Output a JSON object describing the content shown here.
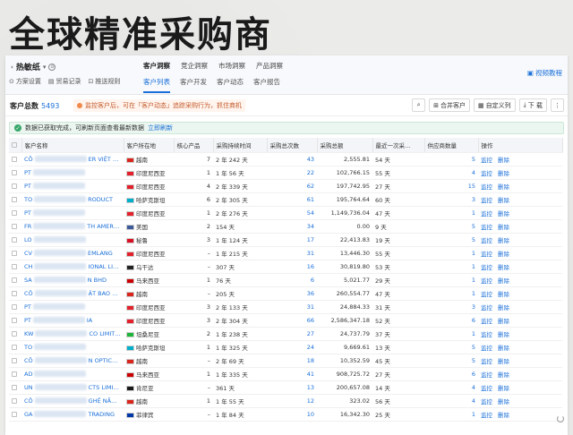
{
  "headline": "全球精准采购商",
  "topbar": {
    "product": "热敏纸",
    "sub_links": [
      "方案设置",
      "贸易记录",
      "推送规则"
    ],
    "main_tabs": [
      {
        "label": "客户洞察",
        "active": true
      },
      {
        "label": "竞企洞察",
        "active": false
      },
      {
        "label": "市场洞察",
        "active": false
      },
      {
        "label": "产品洞察",
        "active": false
      }
    ],
    "sub_tabs": [
      {
        "label": "客户列表",
        "active": true
      },
      {
        "label": "客户开发",
        "active": false
      },
      {
        "label": "客户动态",
        "active": false
      },
      {
        "label": "客户报告",
        "active": false
      }
    ],
    "video_tutorial": "视频教程"
  },
  "toolbar": {
    "total_label": "客户总数",
    "total_value": "5493",
    "warn_text": "监控客户后，可在「客户动态」追踪采购行为，抓住商机",
    "merge_label": "合并客户",
    "custom_cols_label": "自定义列",
    "download_label": "下 载"
  },
  "banner": {
    "text": "数据已获取完成，可刷新页面查看最新数据",
    "refresh": "立即刷新"
  },
  "table": {
    "headers": [
      "客户名称",
      "客户所在地",
      "核心产品",
      "采购持续时间",
      "采购总次数",
      "采购总额",
      "最近一次采…",
      "供应商数量",
      "操作"
    ],
    "rows": [
      {
        "name_pre": "CÔ",
        "name_post": "ER VIỆT N…",
        "country": "越南",
        "flag": "vn",
        "core": "7",
        "duration": "2 年 242 天",
        "count": "43",
        "amount": "2,555.81",
        "last": "54 天",
        "suppliers": "5"
      },
      {
        "name_pre": "PT",
        "name_post": "",
        "country": "印度尼西亚",
        "flag": "id",
        "core": "1",
        "duration": "1 年 56 天",
        "count": "22",
        "amount": "102,766.15",
        "last": "55 天",
        "suppliers": "4"
      },
      {
        "name_pre": "PT",
        "name_post": "",
        "country": "印度尼西亚",
        "flag": "id",
        "core": "4",
        "duration": "2 年 339 天",
        "count": "62",
        "amount": "197,742.95",
        "last": "27 天",
        "suppliers": "15"
      },
      {
        "name_pre": "TO",
        "name_post": "RODUCT",
        "country": "哈萨克斯坦",
        "flag": "kz",
        "core": "6",
        "duration": "2 年 305 天",
        "count": "61",
        "amount": "195,764.64",
        "last": "60 天",
        "suppliers": "3"
      },
      {
        "name_pre": "PT",
        "name_post": "",
        "country": "印度尼西亚",
        "flag": "id",
        "core": "1",
        "duration": "2 年 276 天",
        "count": "54",
        "amount": "1,149,736.04",
        "last": "47 天",
        "suppliers": "1"
      },
      {
        "name_pre": "FR",
        "name_post": "TH AMERI…",
        "country": "美国",
        "flag": "us",
        "core": "2",
        "duration": "154 天",
        "count": "34",
        "amount": "0.00",
        "last": "9 天",
        "suppliers": "5"
      },
      {
        "name_pre": "LO",
        "name_post": "",
        "country": "秘鲁",
        "flag": "pe",
        "core": "3",
        "duration": "1 年 124 天",
        "count": "17",
        "amount": "22,413.83",
        "last": "19 天",
        "suppliers": "5"
      },
      {
        "name_pre": "CV",
        "name_post": "EMLANG",
        "country": "印度尼西亚",
        "flag": "id",
        "core": "–",
        "duration": "1 年 215 天",
        "count": "31",
        "amount": "13,446.30",
        "last": "55 天",
        "suppliers": "1"
      },
      {
        "name_pre": "CH",
        "name_post": "IONAL LIM…",
        "country": "乌干达",
        "flag": "ug",
        "core": "–",
        "duration": "307 天",
        "count": "16",
        "amount": "30,819.80",
        "last": "53 天",
        "suppliers": "1"
      },
      {
        "name_pre": "SA",
        "name_post": "N BHD",
        "country": "马来西亚",
        "flag": "my",
        "core": "1",
        "duration": "76 天",
        "count": "6",
        "amount": "5,021.77",
        "last": "29 天",
        "suppliers": "1"
      },
      {
        "name_pre": "CÔ",
        "name_post": "ẬT BAO B…",
        "country": "越南",
        "flag": "vn",
        "core": "–",
        "duration": "205 天",
        "count": "36",
        "amount": "260,554.77",
        "last": "47 天",
        "suppliers": "1"
      },
      {
        "name_pre": "PT",
        "name_post": "",
        "country": "印度尼西亚",
        "flag": "id",
        "core": "3",
        "duration": "2 年 133 天",
        "count": "31",
        "amount": "24,884.33",
        "last": "31 天",
        "suppliers": "3"
      },
      {
        "name_pre": "PT",
        "name_post": "IA",
        "country": "印度尼西亚",
        "flag": "id",
        "core": "3",
        "duration": "2 年 304 天",
        "count": "66",
        "amount": "2,586,347.18",
        "last": "52 天",
        "suppliers": "6"
      },
      {
        "name_pre": "KW",
        "name_post": "CO LIMITED",
        "country": "坦桑尼亚",
        "flag": "tz",
        "core": "2",
        "duration": "1 年 238 天",
        "count": "27",
        "amount": "24,737.79",
        "last": "37 天",
        "suppliers": "1"
      },
      {
        "name_pre": "TO",
        "name_post": "",
        "country": "哈萨克斯坦",
        "flag": "kz",
        "core": "1",
        "duration": "1 年 325 天",
        "count": "24",
        "amount": "9,669.61",
        "last": "13 天",
        "suppliers": "5"
      },
      {
        "name_pre": "CÔ",
        "name_post": "N OPTICA…",
        "country": "越南",
        "flag": "vn",
        "core": "–",
        "duration": "2 年 69 天",
        "count": "18",
        "amount": "10,352.59",
        "last": "45 天",
        "suppliers": "5"
      },
      {
        "name_pre": "AD",
        "name_post": "",
        "country": "马来西亚",
        "flag": "my",
        "core": "1",
        "duration": "1 年 335 天",
        "count": "41",
        "amount": "908,725.72",
        "last": "27 天",
        "suppliers": "6"
      },
      {
        "name_pre": "UN",
        "name_post": "CTS LIMIT…",
        "country": "肯尼亚",
        "flag": "ke",
        "core": "–",
        "duration": "361 天",
        "count": "13",
        "amount": "200,657.08",
        "last": "14 天",
        "suppliers": "4"
      },
      {
        "name_pre": "CÔ",
        "name_post": "GHỆ NĂN…",
        "country": "越南",
        "flag": "vn",
        "core": "1",
        "duration": "1 年 55 天",
        "count": "12",
        "amount": "323.02",
        "last": "56 天",
        "suppliers": "4"
      },
      {
        "name_pre": "GA",
        "name_post": "TRADING",
        "country": "菲律宾",
        "flag": "ph",
        "core": "–",
        "duration": "1 年 84 天",
        "count": "10",
        "amount": "16,342.30",
        "last": "25 天",
        "suppliers": "1"
      }
    ],
    "op_monitor": "监控",
    "op_delete": "删除"
  },
  "flag_colors": {
    "vn": "#da251d",
    "id": "#e4202b",
    "kz": "#00afca",
    "us": "#3c5a9a",
    "pe": "#d91023",
    "ug": "#222222",
    "my": "#cc0001",
    "tz": "#1eb53a",
    "ke": "#1a1a1a",
    "ph": "#0038a8"
  }
}
